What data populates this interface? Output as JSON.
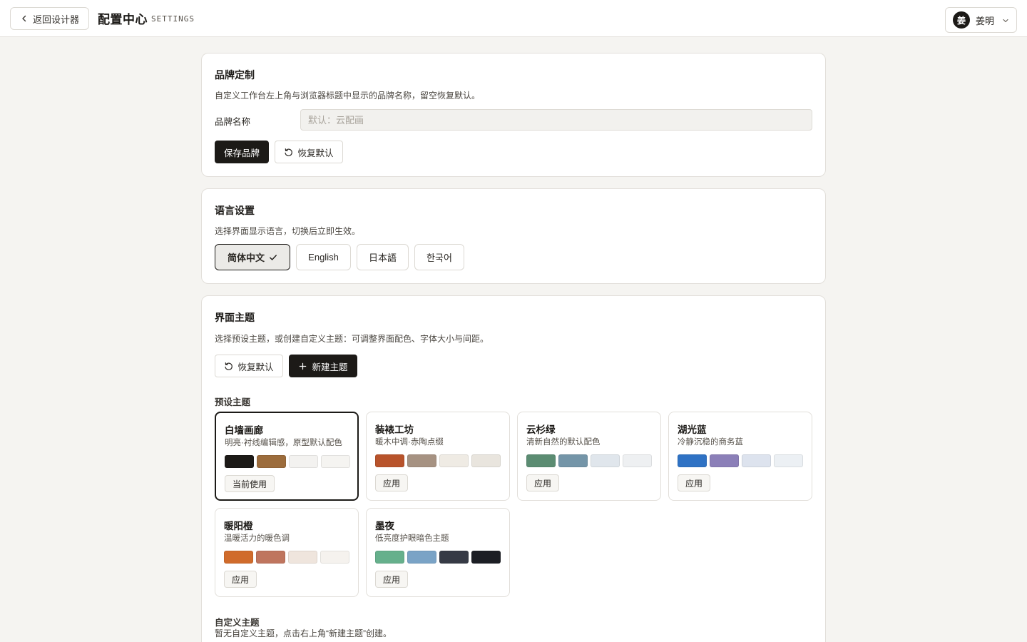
{
  "header": {
    "back_label": "返回设计器",
    "title": "配置中心",
    "subtitle": "SETTINGS",
    "user": {
      "avatar_char": "姜",
      "name": "姜明"
    }
  },
  "brand": {
    "title": "品牌定制",
    "description": "自定义工作台左上角与浏览器标题中显示的品牌名称，留空恢复默认。",
    "field_label": "品牌名称",
    "input_value": "",
    "input_placeholder": "默认：云配画",
    "save_label": "保存品牌",
    "reset_label": "恢复默认"
  },
  "language": {
    "title": "语言设置",
    "description": "选择界面显示语言，切换后立即生效。",
    "options": [
      {
        "label": "简体中文",
        "selected": true
      },
      {
        "label": "English",
        "selected": false
      },
      {
        "label": "日本語",
        "selected": false
      },
      {
        "label": "한국어",
        "selected": false
      }
    ]
  },
  "themes": {
    "title": "界面主题",
    "description": "选择预设主题，或创建自定义主题：可调整界面配色、字体大小与间距。",
    "reset_label": "恢复默认",
    "new_label": "新建主题",
    "preset_label": "预设主题",
    "presets": [
      {
        "name": "白墙画廊",
        "desc": "明亮·衬线编辑感，原型默认配色",
        "colors": [
          "#1c1a17",
          "#9c6c3c",
          "#f3f2f0",
          "#f5f4f1"
        ],
        "button": "当前使用",
        "current": true
      },
      {
        "name": "装裱工坊",
        "desc": "暖木中调·赤陶点缀",
        "colors": [
          "#b8532b",
          "#a69282",
          "#efebe4",
          "#e9e5de"
        ],
        "button": "应用",
        "current": false
      },
      {
        "name": "云杉绿",
        "desc": "清新自然的默认配色",
        "colors": [
          "#5b8c72",
          "#7495a8",
          "#e0e6ec",
          "#eef0f2"
        ],
        "button": "应用",
        "current": false
      },
      {
        "name": "湖光蓝",
        "desc": "冷静沉稳的商务蓝",
        "colors": [
          "#2f72c4",
          "#8b7fb8",
          "#dde3ee",
          "#ecf0f4"
        ],
        "button": "应用",
        "current": false
      },
      {
        "name": "暖阳橙",
        "desc": "温暖活力的暖色调",
        "colors": [
          "#d06b2b",
          "#bf755e",
          "#efe5dd",
          "#f5f2ee"
        ],
        "button": "应用",
        "current": false
      },
      {
        "name": "墨夜",
        "desc": "低亮度护眼暗色主题",
        "colors": [
          "#66b08c",
          "#7aa3c6",
          "#363a45",
          "#1c1e24"
        ],
        "button": "应用",
        "current": false
      }
    ],
    "custom_label": "自定义主题",
    "custom_empty": "暂无自定义主题，点击右上角“新建主题”创建。"
  }
}
